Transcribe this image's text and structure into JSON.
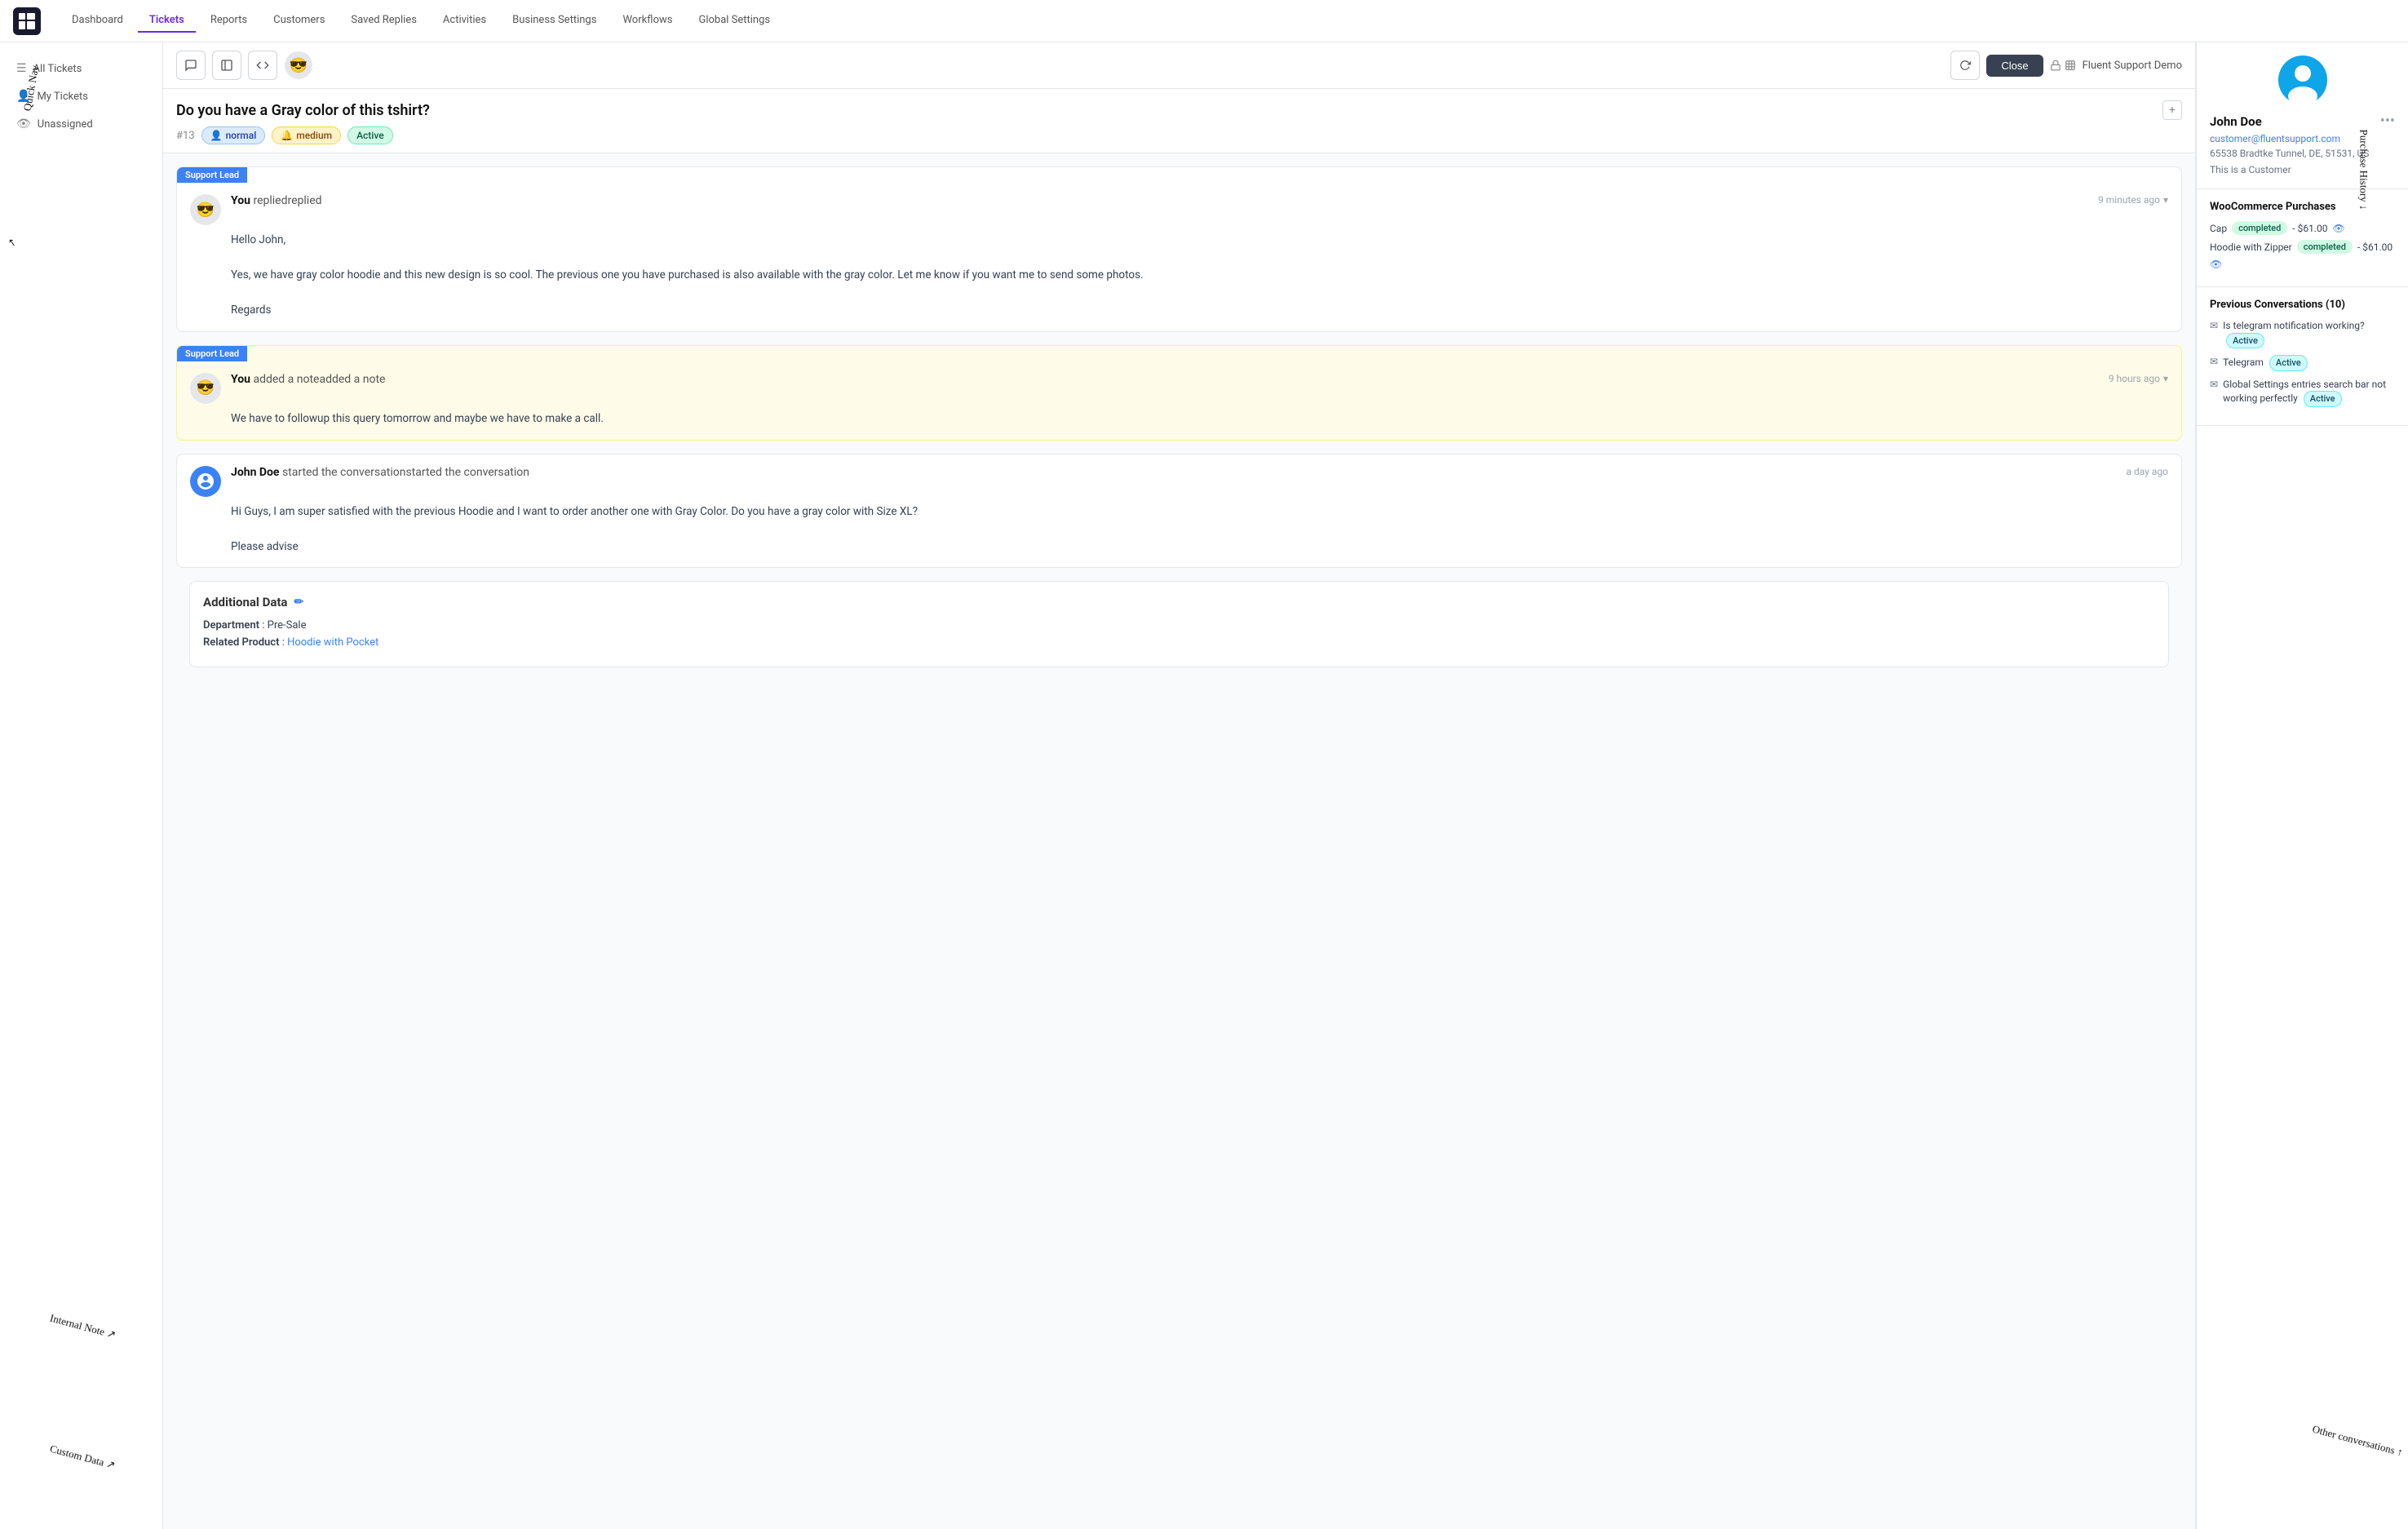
{
  "app": {
    "logo": "≡",
    "nav": {
      "items": [
        {
          "label": "Dashboard",
          "active": false
        },
        {
          "label": "Tickets",
          "active": true
        },
        {
          "label": "Reports",
          "active": false
        },
        {
          "label": "Customers",
          "active": false
        },
        {
          "label": "Saved Replies",
          "active": false
        },
        {
          "label": "Activities",
          "active": false
        },
        {
          "label": "Business Settings",
          "active": false
        },
        {
          "label": "Workflows",
          "active": false
        },
        {
          "label": "Global Settings",
          "active": false
        }
      ]
    }
  },
  "sidebar": {
    "items": [
      {
        "label": "All Tickets",
        "icon": "☰"
      },
      {
        "label": "My Tickets",
        "icon": "👤"
      },
      {
        "label": "Unassigned",
        "icon": "👁"
      }
    ]
  },
  "ticket": {
    "title": "Do you have a Gray color of this tshirt?",
    "number": "#13",
    "badges": {
      "priority": "normal",
      "medium": "medium",
      "status": "Active"
    },
    "close_label": "Close",
    "source_label": "Fluent Support Demo"
  },
  "messages": [
    {
      "type": "reply",
      "badge": "Support Lead",
      "sender": "You",
      "action": "replied",
      "time": "9 minutes ago",
      "avatar": "😎",
      "body": "Hello John,\n\nYes, we have gray color hoodie and this new design is so cool. The previous one you have purchased is also available with the gray color. Let me know if you want me to send some photos.\n\nRegards"
    },
    {
      "type": "note",
      "badge": "Support Lead",
      "sender": "You",
      "action": "added a note",
      "time": "9 hours ago",
      "avatar": "😎",
      "body": "We have to followup this query tomorrow and maybe we have to make a call."
    },
    {
      "type": "conversation",
      "sender": "John Doe",
      "action": "started the conversation",
      "time": "a day ago",
      "avatar_type": "blue",
      "body": "Hi Guys, I am super satisfied with the previous Hoodie and I want to order another one with Gray Color. Do you have a gray color with Size XL?\n\nPlease advise"
    }
  ],
  "additional_data": {
    "title": "Additional Data",
    "fields": [
      {
        "label": "Department",
        "value": "Pre-Sale",
        "link": false
      },
      {
        "label": "Related Product",
        "value": "Hoodie with Pocket",
        "link": true
      }
    ]
  },
  "customer": {
    "name": "John Doe",
    "email": "customer@fluentsupport.com",
    "address": "65538 Bradtke Tunnel, DE, 51531, US",
    "type": "This is a Customer"
  },
  "woocommerce": {
    "title": "WooCommerce Purchases",
    "items": [
      {
        "product": "Cap",
        "status": "completed",
        "amount": "- $61.00"
      },
      {
        "product": "Hoodie with Zipper",
        "status": "completed",
        "amount": "- $61.00"
      }
    ]
  },
  "previous_conversations": {
    "title": "Previous Conversations (10)",
    "items": [
      {
        "text": "Is telegram notification working?",
        "status": "Active",
        "status_color": "active"
      },
      {
        "text": "Telegram",
        "status": "Active",
        "status_color": "active"
      },
      {
        "text": "Global Settings entries search bar not working perfectly",
        "status": "Active",
        "status_color": "active"
      }
    ]
  },
  "annotations": {
    "quick_nav": "Quick\nNav",
    "purchase_history": "Purchase History",
    "internal_note": "Internal Note",
    "custom_data": "Custom Data",
    "other_conversations": "Other conversations"
  }
}
